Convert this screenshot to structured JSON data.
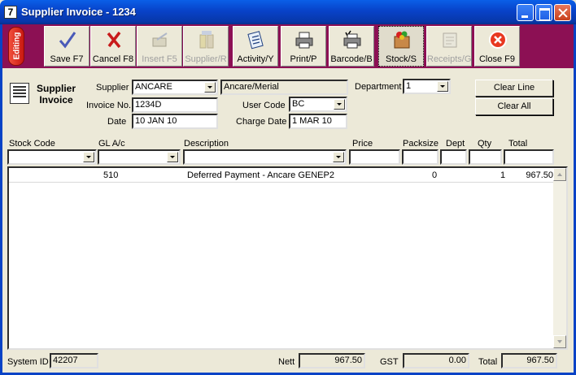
{
  "window": {
    "title": "Supplier Invoice - 1234",
    "app_icon_text": "7"
  },
  "toolbar": {
    "mode_label": "Editing",
    "buttons": [
      {
        "label": "Save F7",
        "icon": "checkmark-pen-icon",
        "enabled": true
      },
      {
        "label": "Cancel F8",
        "icon": "cancel-x-icon",
        "enabled": true
      },
      {
        "label": "Insert F5",
        "icon": "insert-icon",
        "enabled": false
      },
      {
        "label": "Supplier/R",
        "icon": "supplier-icon",
        "enabled": false
      },
      {
        "label": "Activity/Y",
        "icon": "activity-icon",
        "enabled": true
      },
      {
        "label": "Print/P",
        "icon": "printer-icon",
        "enabled": true
      },
      {
        "label": "Barcode/B",
        "icon": "barcode-printer-icon",
        "enabled": true
      },
      {
        "label": "Stock/S",
        "icon": "stock-icon",
        "enabled": true
      },
      {
        "label": "Receipts/G",
        "icon": "receipts-icon",
        "enabled": false
      },
      {
        "label": "Close F9",
        "icon": "close-circle-icon",
        "enabled": true
      }
    ]
  },
  "form": {
    "heading_line1": "Supplier",
    "heading_line2": "Invoice",
    "supplier_label": "Supplier",
    "supplier_value": "ANCARE",
    "supplier_name": "Ancare/Merial",
    "invoice_no_label": "Invoice No.",
    "invoice_no_value": "1234D",
    "date_label": "Date",
    "date_value": "10 JAN 10",
    "department_label": "Department",
    "department_value": "1",
    "user_code_label": "User Code",
    "user_code_value": "BC",
    "charge_date_label": "Charge Date",
    "charge_date_value": "1 MAR 10",
    "clear_line_label": "Clear Line",
    "clear_all_label": "Clear All"
  },
  "grid": {
    "columns": [
      "Stock Code",
      "GL A/c",
      "Description",
      "Price",
      "Packsize",
      "Dept",
      "Qty",
      "Total"
    ],
    "rows": [
      {
        "stock_code": "",
        "gl": "510",
        "description": "Deferred Payment - Ancare GENEP2",
        "price": "",
        "packsize": "0",
        "dept": "",
        "qty": "1",
        "total": "967.50"
      }
    ]
  },
  "footer": {
    "system_id_label": "System ID",
    "system_id_value": "42207",
    "nett_label": "Nett",
    "nett_value": "967.50",
    "gst_label": "GST",
    "gst_value": "0.00",
    "total_label": "Total",
    "total_value": "967.50"
  },
  "colors": {
    "toolbar_bg": "#8C1054",
    "window_bg": "#ECE9D8",
    "title_bar": "#0842C8"
  }
}
